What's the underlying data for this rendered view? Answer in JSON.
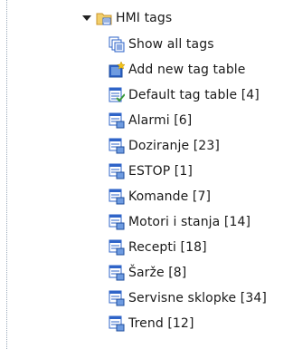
{
  "tree": {
    "root": {
      "label": "HMI tags",
      "expanded": true,
      "icon": "folder-icon"
    },
    "items": [
      {
        "label": "Show all tags",
        "icon": "show-all-tags-icon"
      },
      {
        "label": "Add new tag table",
        "icon": "add-tag-table-icon"
      },
      {
        "label": "Default tag table [4]",
        "icon": "default-tag-table-icon"
      },
      {
        "label": "Alarmi [6]",
        "icon": "tag-table-icon"
      },
      {
        "label": "Doziranje [23]",
        "icon": "tag-table-icon"
      },
      {
        "label": "ESTOP [1]",
        "icon": "tag-table-icon"
      },
      {
        "label": "Komande [7]",
        "icon": "tag-table-icon"
      },
      {
        "label": "Motori i stanja [14]",
        "icon": "tag-table-icon"
      },
      {
        "label": "Recepti [18]",
        "icon": "tag-table-icon"
      },
      {
        "label": "Šarže [8]",
        "icon": "tag-table-icon"
      },
      {
        "label": "Servisne sklopke [34]",
        "icon": "tag-table-icon"
      },
      {
        "label": "Trend [12]",
        "icon": "tag-table-icon"
      }
    ]
  },
  "colors": {
    "folder": "#e8b64a",
    "table_blue": "#2f64c8",
    "table_green": "#3c9a3c",
    "star": "#f2c21b"
  }
}
